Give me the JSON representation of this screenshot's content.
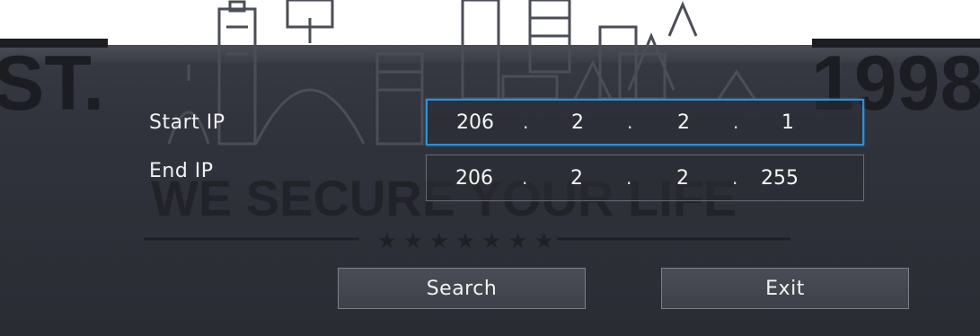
{
  "watermark": {
    "left_text": "ST.",
    "right_text": "1998",
    "center_text": "WE SECURE YOUR LIFE",
    "stars": "★ ★ ★ ★ ★ ★ ★"
  },
  "form": {
    "start_label": "Start IP",
    "end_label": "End IP",
    "start_ip": [
      "206",
      "2",
      "2",
      "1"
    ],
    "end_ip": [
      "206",
      "2",
      "2",
      "255"
    ],
    "separator": "."
  },
  "buttons": {
    "search_label": "Search",
    "exit_label": "Exit"
  },
  "colors": {
    "background": "#30333b",
    "focus_border": "#2f8fd6",
    "text": "#f2f2f2"
  }
}
